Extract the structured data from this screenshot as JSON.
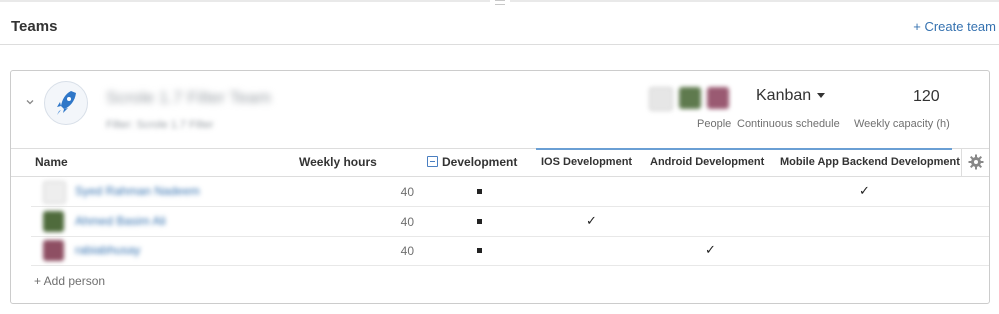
{
  "header": {
    "title": "Teams",
    "create_team": "+ Create team"
  },
  "team": {
    "name": "Scrole 1.7 Filter Team",
    "filter": "Filter: Scrole 1.7 Filter",
    "people_label": "People",
    "schedule": "Kanban",
    "schedule_label": "Continuous schedule",
    "capacity": "120",
    "capacity_label": "Weekly capacity (h)"
  },
  "columns": {
    "name": "Name",
    "weekly_hours": "Weekly hours",
    "development": "Development",
    "skills": [
      "IOS Development",
      "Android Development",
      "Mobile App Backend Development"
    ]
  },
  "rows": [
    {
      "name": "Syed Rahman Nadeem",
      "hours": "40",
      "square": "■",
      "check": "✓"
    },
    {
      "name": "Ahmed Basim Ali",
      "hours": "40",
      "square": "■",
      "check": "✓"
    },
    {
      "name": "rabiabhusay",
      "hours": "40",
      "square": "■",
      "check": "✓"
    }
  ],
  "add_person": "+ Add person",
  "colors": {
    "link": "#3572b0",
    "accent_rule": "#6a9fd4",
    "border": "#cccccc"
  },
  "icons": [
    "chevron-down-icon",
    "rocket-icon",
    "caret-down-icon",
    "collapse-minus-icon",
    "gear-icon",
    "checkmark-icon"
  ]
}
